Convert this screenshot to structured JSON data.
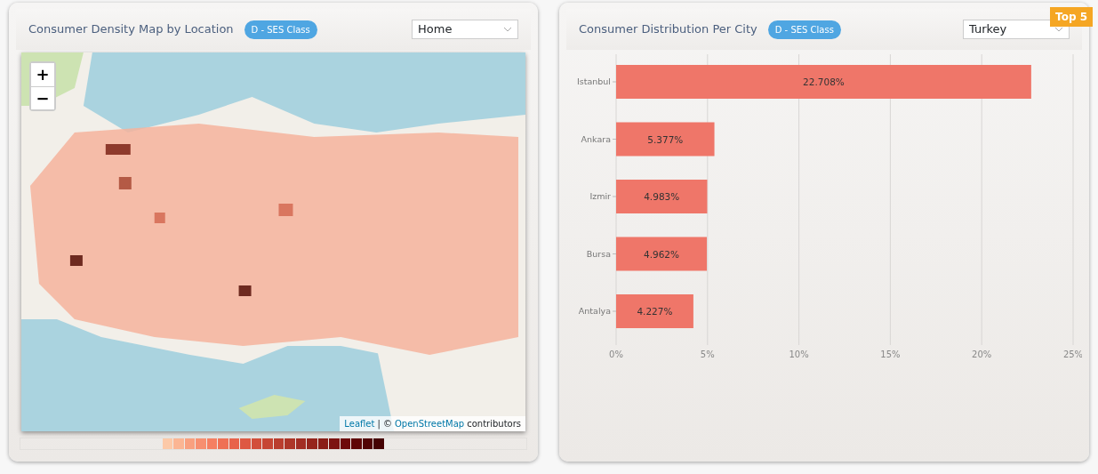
{
  "map_panel": {
    "title": "Consumer Density Map by Location",
    "badge": "D - SES Class",
    "dropdown": {
      "value": "Home"
    },
    "map": {
      "kind": "picture",
      "zoom_in": "+",
      "zoom_out": "−",
      "attribution": {
        "link": "Leaflet",
        "separator": "| ©",
        "source_link": "OpenStreetMap",
        "suffix": "contributors"
      }
    },
    "legend": [
      {
        "color": "#fcc9a8"
      },
      {
        "color": "#fbb593"
      },
      {
        "color": "#f9a07f"
      },
      {
        "color": "#f78f70"
      },
      {
        "color": "#f57f62"
      },
      {
        "color": "#ef7055"
      },
      {
        "color": "#e8634b"
      },
      {
        "color": "#de5842"
      },
      {
        "color": "#d24f3b"
      },
      {
        "color": "#c64634"
      },
      {
        "color": "#ba3e2e"
      },
      {
        "color": "#ae3628"
      },
      {
        "color": "#a22d23"
      },
      {
        "color": "#96251d"
      },
      {
        "color": "#8a1d17"
      },
      {
        "color": "#7d1311"
      },
      {
        "color": "#6e0a0a"
      },
      {
        "color": "#5f0606"
      },
      {
        "color": "#520404"
      },
      {
        "color": "#450202"
      }
    ]
  },
  "distribution_panel": {
    "title": "Consumer Distribution Per City",
    "badge": "D - SES Class",
    "dropdown": {
      "value": "Turkey"
    },
    "ribbon": "Top 5",
    "chart_data": {
      "type": "bar",
      "orientation": "horizontal",
      "categories": [
        "Istanbul",
        "Ankara",
        "Izmir",
        "Bursa",
        "Antalya"
      ],
      "grid": true,
      "series": [
        {
          "color": "#ef7669",
          "values": [
            22.708,
            5.377,
            4.983,
            4.962,
            4.227
          ]
        }
      ],
      "value_labels": [
        "22.708%",
        "5.377%",
        "4.983%",
        "4.962%",
        "4.227%"
      ],
      "xlim": [
        0,
        25
      ],
      "xticks": [
        {
          "value": 0,
          "label": "0%"
        },
        {
          "value": 5,
          "label": "5%"
        },
        {
          "value": 10,
          "label": "10%"
        },
        {
          "value": 15,
          "label": "15%"
        },
        {
          "value": 20,
          "label": "20%"
        },
        {
          "value": 25,
          "label": "25%"
        }
      ]
    }
  }
}
